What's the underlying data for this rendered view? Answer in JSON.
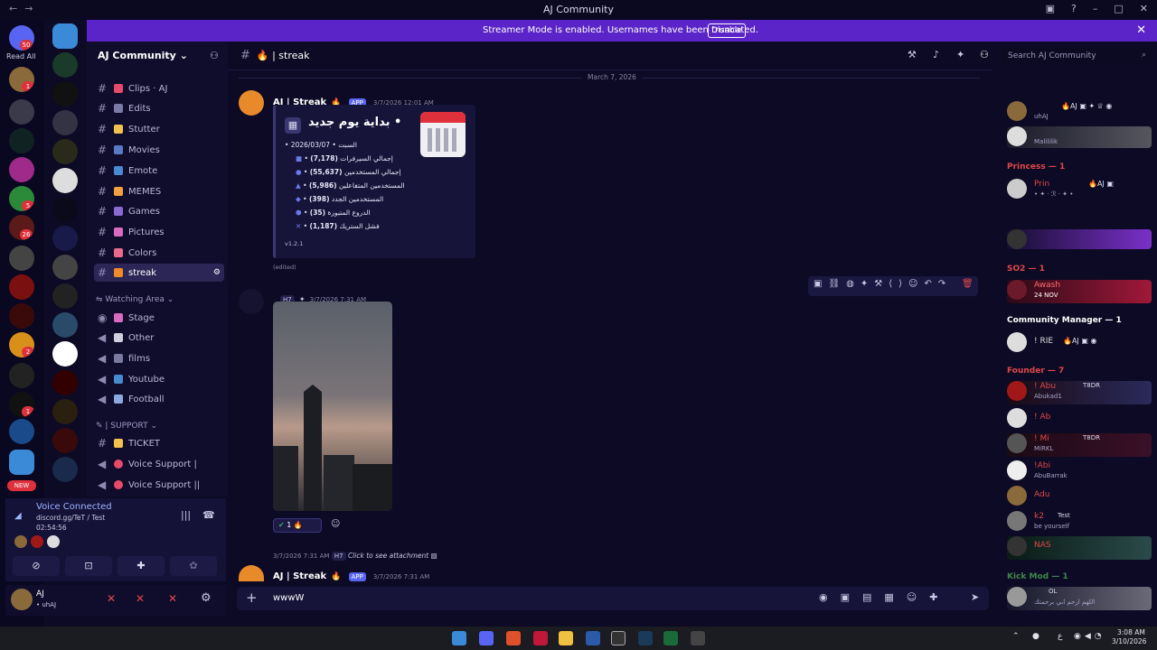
{
  "window": {
    "title": "AJ Community"
  },
  "banner": {
    "text": "Streamer Mode is enabled. Usernames have been truncated.",
    "button": "Disable"
  },
  "rail": {
    "read_all": "Read All",
    "new_badge": "NEW",
    "badges": [
      "50",
      "1",
      "5",
      "26",
      "2",
      "1"
    ]
  },
  "guild": {
    "name": "AJ Community"
  },
  "channels": [
    {
      "label": "Clips · AJ",
      "type": "text",
      "emoji_color": "#e84a6a"
    },
    {
      "label": "Edits",
      "type": "text",
      "emoji_color": "#7c7aa8"
    },
    {
      "label": "Stutter",
      "type": "text",
      "emoji_color": "#f2c14e"
    },
    {
      "label": "Movies",
      "type": "text",
      "emoji_color": "#5a7ac8"
    },
    {
      "label": "Emote",
      "type": "text",
      "emoji_color": "#4a8ad0"
    },
    {
      "label": "MEMES",
      "type": "text",
      "emoji_color": "#f0a040"
    },
    {
      "label": "Games",
      "type": "text",
      "emoji_color": "#8a6ad0"
    },
    {
      "label": "Pictures",
      "type": "text",
      "emoji_color": "#d86ac0"
    },
    {
      "label": "Colors",
      "type": "text",
      "emoji_color": "#e86a8a"
    },
    {
      "label": "streak",
      "type": "text",
      "emoji_color": "#f08a2a",
      "active": true
    }
  ],
  "watching_area": {
    "label": "Watching Area",
    "items": [
      {
        "label": "Stage",
        "emoji_color": "#d86ac0"
      },
      {
        "label": "Other",
        "emoji_color": "#cfcfe0"
      },
      {
        "label": "films",
        "emoji_color": "#7a7aa0"
      },
      {
        "label": "Youtube",
        "emoji_color": "#4a8ad0"
      },
      {
        "label": "Football",
        "emoji_color": "#8aaae0"
      }
    ]
  },
  "support": {
    "label": "SUPPORT",
    "items": [
      {
        "label": "TICKET",
        "emoji_color": "#f2c14e"
      },
      {
        "label": "Voice Support |",
        "emoji_color": "#e84a6a"
      },
      {
        "label": "Voice Support ||",
        "emoji_color": "#e84a6a"
      }
    ]
  },
  "voice": {
    "status": "Voice Connected",
    "channel": "discord.gg/TeT / Test",
    "timer": "02:54:56"
  },
  "user": {
    "name": "AJ",
    "status": "• uhAJ"
  },
  "chat": {
    "channel": "streak",
    "search_placeholder": "Search AJ Community",
    "date_divider": "March 7, 2026",
    "message1": {
      "author": "AJ | Streak",
      "badge": "APP",
      "timestamp": "3/7/2026 12:01 AM",
      "embed_title": "بداية يوم جديد •",
      "date_line": "• 2026/03/07 • السبت",
      "stats": [
        {
          "value": "(7,178)",
          "label": "إجمالي السيرفرات"
        },
        {
          "value": "(55,637)",
          "label": "إجمالي المستخدمين"
        },
        {
          "value": "(5,986)",
          "label": "المستخدمين المتفاعلين"
        },
        {
          "value": "(398)",
          "label": "المستخدمين الجدد"
        },
        {
          "value": "(35)",
          "label": "الدروع المتبوزة"
        },
        {
          "value": "(1,187)",
          "label": "فشل الستريك"
        }
      ],
      "version": "v1.2.1",
      "edited": "(edited)"
    },
    "message2": {
      "author_tag": "H7",
      "timestamp": "3/7/2026 7:31 AM",
      "reaction_count": "1"
    },
    "reply_preview": {
      "time": "3/7/2026 7:31 AM",
      "author_tag": "H7",
      "text": "Click to see attachment"
    },
    "message3": {
      "author": "AJ | Streak",
      "badge": "APP",
      "timestamp": "3/7/2026 7:31 AM"
    },
    "composer_value": "wwwW"
  },
  "members": {
    "rows": [
      {
        "top": "uhAJ",
        "name": "",
        "sub": "uhAJ",
        "color": "#ffffff",
        "tags": "AJ"
      },
      {
        "name": "",
        "sub": "Malililik",
        "color": "#ffffff"
      },
      {
        "role": "Princess — 1",
        "color": "#e04848"
      },
      {
        "name": "Prin",
        "sub": "• ✦ · ℛ · ✦ •",
        "color": "#e04848",
        "tags": "AJ"
      },
      {
        "role": "SO2 — 1",
        "color": "#e04848"
      },
      {
        "name": "Awash",
        "sub": "24 NOV",
        "color": "#e04848"
      },
      {
        "role": "Community Manager — 1",
        "color": "#ffffff"
      },
      {
        "name": "! RIE",
        "sub": "",
        "color": "#dddddd",
        "tags": "AJ"
      },
      {
        "role": "Founder — 7",
        "color": "#e04848"
      },
      {
        "name": "! Abu",
        "sub": "Abukad1",
        "color": "#e04848",
        "tags": "T8DR"
      },
      {
        "name": "! Ab",
        "sub": "",
        "color": "#e04848"
      },
      {
        "name": "! Mi",
        "sub": "MiRKL",
        "color": "#e04848",
        "tags": "T8DR"
      },
      {
        "name": "!Abi",
        "sub": "AbuBarrak",
        "color": "#e04848"
      },
      {
        "name": "Adu",
        "sub": "",
        "color": "#e04848"
      },
      {
        "name": "k2",
        "sub": "be yourself",
        "color": "#e04848",
        "tags": "Test"
      },
      {
        "name": "NAS",
        "sub": "",
        "color": "#e04848"
      },
      {
        "role": "Kick Mod — 1",
        "color": "#3a8a4a"
      },
      {
        "name": "",
        "sub": "اللهم ارحم ابي برحمتك",
        "color": "#ffffff",
        "tags": "OL"
      }
    ]
  },
  "taskbar": {
    "lang": "ع",
    "time": "3:08 AM",
    "date": "3/10/2026"
  }
}
